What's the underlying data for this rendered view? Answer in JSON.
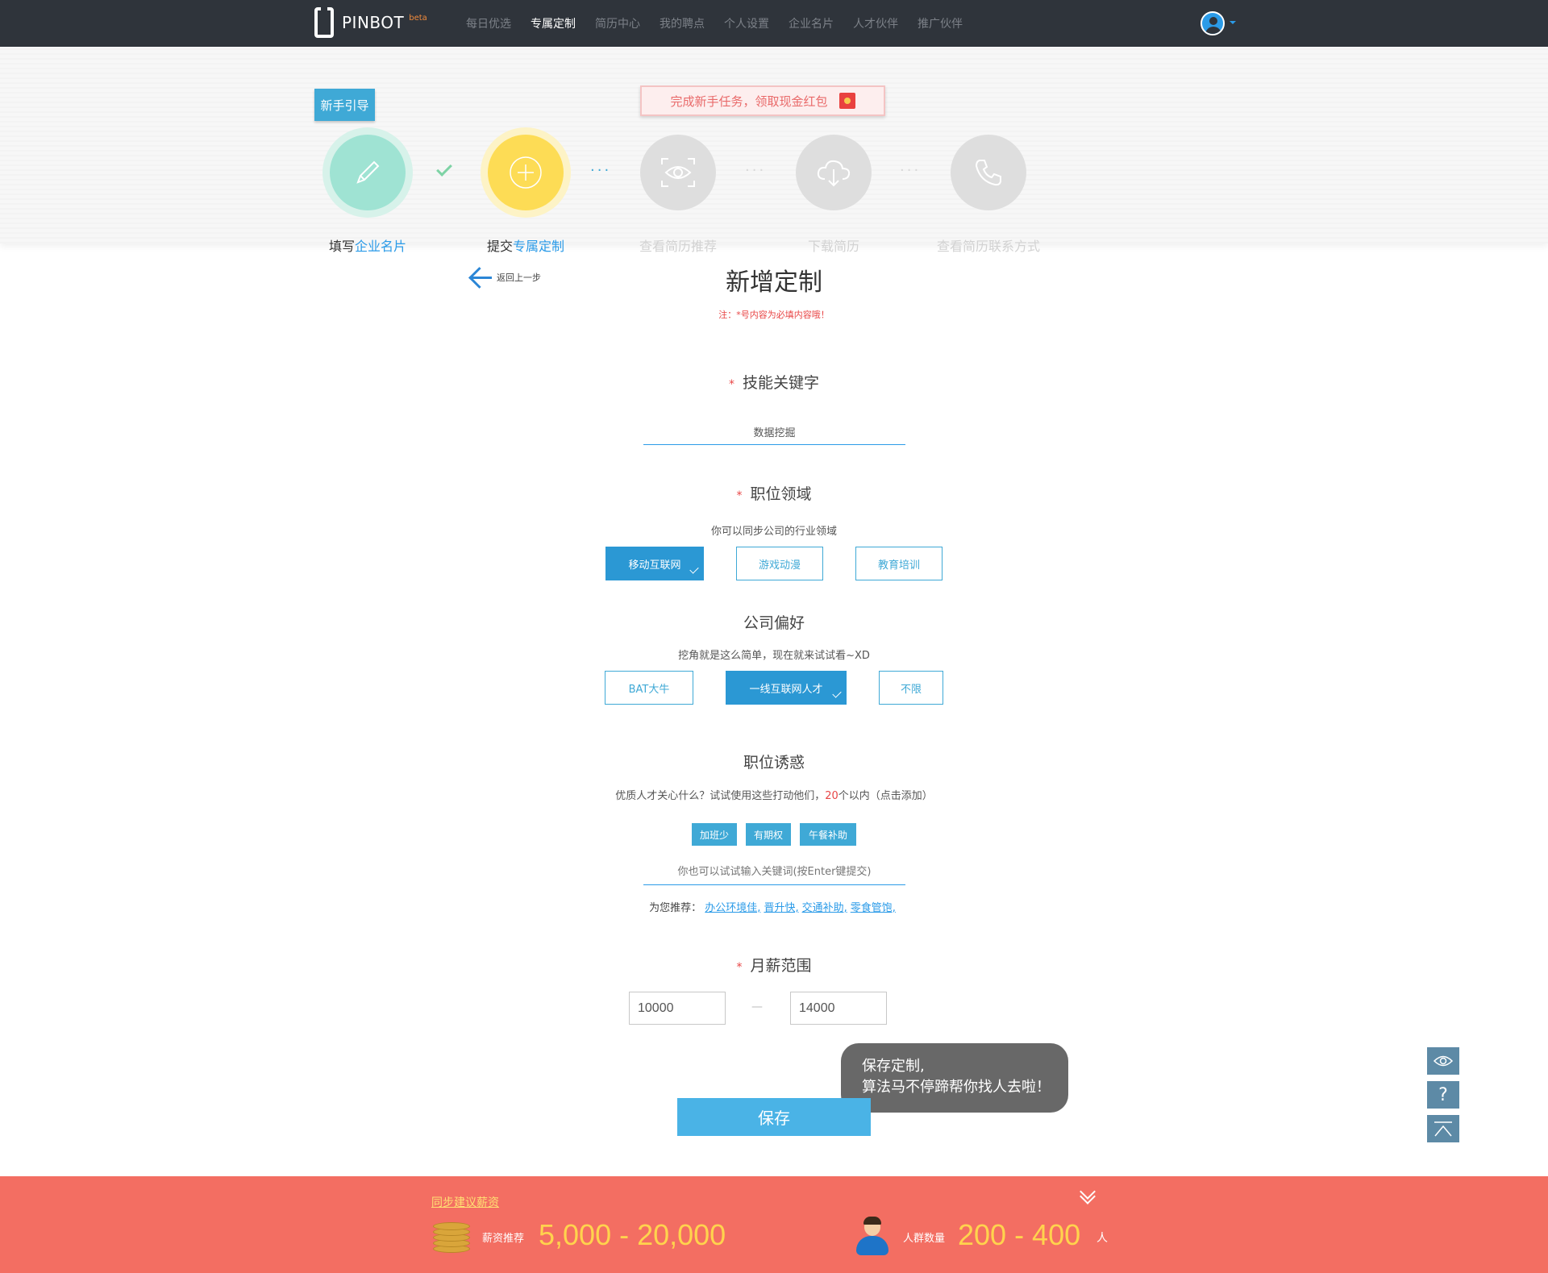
{
  "nav": {
    "brand": "PINBOT",
    "brand_beta": "beta",
    "items": [
      {
        "label": "每日优选",
        "active": false
      },
      {
        "label": "专属定制",
        "active": true
      },
      {
        "label": "简历中心",
        "active": false
      },
      {
        "label": "我的聘点",
        "active": false
      },
      {
        "label": "个人设置",
        "active": false
      },
      {
        "label": "企业名片",
        "active": false
      },
      {
        "label": "人才伙伴",
        "active": false
      },
      {
        "label": "推广伙伴",
        "active": false
      }
    ]
  },
  "guide": {
    "flag": "新手引导",
    "promo": "完成新手任务，领取现金红包",
    "steps": [
      {
        "label_plain": "填写",
        "label_highlight": "企业名片",
        "icon": "pencil-icon",
        "state": "done"
      },
      {
        "label_plain": "提交",
        "label_highlight": "专属定制",
        "icon": "plus-icon",
        "state": "current"
      },
      {
        "label": "查看简历推荐",
        "icon": "eye-scan-icon",
        "state": "disabled"
      },
      {
        "label": "下载简历",
        "icon": "cloud-download-icon",
        "state": "disabled"
      },
      {
        "label": "查看简历联系方式",
        "icon": "phone-icon",
        "state": "disabled"
      }
    ]
  },
  "form": {
    "back_label": "返回上一步",
    "title": "新增定制",
    "note": "注：*号内容为必填内容哦！",
    "skill": {
      "title": "技能关键字",
      "value": "数据挖掘"
    },
    "field": {
      "title": "职位领域",
      "hint": "你可以同步公司的行业领域",
      "options": [
        {
          "label": "移动互联网",
          "selected": true
        },
        {
          "label": "游戏动漫",
          "selected": false
        },
        {
          "label": "教育培训",
          "selected": false
        }
      ]
    },
    "company": {
      "title": "公司偏好",
      "hint": "挖角就是这么简单，现在就来试试看~XD",
      "options": [
        {
          "label": "BAT大牛",
          "selected": false
        },
        {
          "label": "一线互联网人才",
          "selected": true
        },
        {
          "label": "不限",
          "selected": false
        }
      ]
    },
    "perks": {
      "title": "职位诱惑",
      "hint_before": "优质人才关心什么？试试使用这些打动他们，",
      "hint_count": "20",
      "hint_after": "个以内（点击添加）",
      "tags": [
        "加班少",
        "有期权",
        "午餐补助"
      ],
      "input_placeholder": "你也可以试试输入关键词(按Enter键提交)",
      "recommend_label": "为您推荐：",
      "recommendations": [
        "办公环境佳,",
        "晋升快,",
        "交通补助,",
        "零食管饱,"
      ]
    },
    "salary": {
      "title": "月薪范围",
      "min": "10000",
      "max": "14000",
      "separator": "—"
    },
    "bubble_line1": "保存定制,",
    "bubble_line2": "算法马不停蹄帮你找人去啦！",
    "save_label": "保存"
  },
  "side_tools": [
    {
      "icon": "eye-icon"
    },
    {
      "icon": "question-icon",
      "glyph": "?"
    },
    {
      "icon": "back-to-top-icon"
    }
  ],
  "footer": {
    "link": "同步建议薪资",
    "salary_label": "薪资推荐",
    "salary_value": "5,000 - 20,000",
    "crowd_label": "人群数量",
    "crowd_value": "200 - 400",
    "crowd_unit": "人"
  },
  "colors": {
    "topbar": "#2f343b",
    "accent": "#2b98d4",
    "footer": "#f36e62",
    "footer_value": "#ffd34d",
    "required": "#e84545"
  }
}
